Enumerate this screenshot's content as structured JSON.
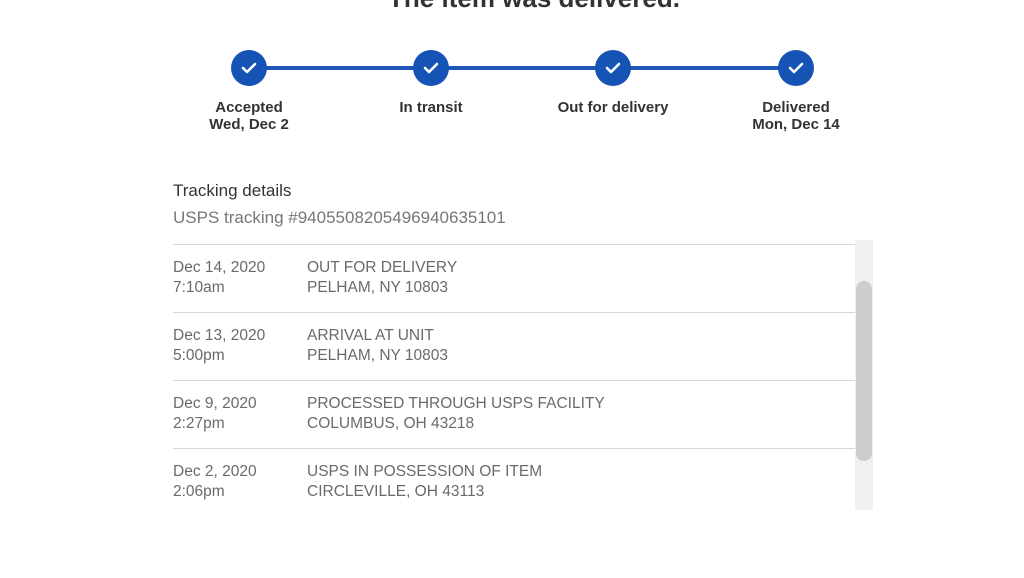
{
  "header": {
    "title": "The item was delivered."
  },
  "progress": {
    "accent_color": "#1553b5",
    "steps": [
      {
        "label": "Accepted",
        "date": "Wed, Dec 2",
        "completed": true,
        "icon": "check-icon"
      },
      {
        "label": "In transit",
        "date": "",
        "completed": true,
        "icon": "check-icon"
      },
      {
        "label": "Out for delivery",
        "date": "",
        "completed": true,
        "icon": "check-icon"
      },
      {
        "label": "Delivered",
        "date": "Mon, Dec 14",
        "completed": true,
        "icon": "check-icon"
      }
    ]
  },
  "tracking": {
    "title": "Tracking details",
    "number_text": "USPS tracking #9405508205496940635101",
    "events": [
      {
        "date": "Dec 14, 2020",
        "time": "7:10am",
        "status": "OUT FOR DELIVERY",
        "location": "PELHAM, NY 10803"
      },
      {
        "date": "Dec 13, 2020",
        "time": "5:00pm",
        "status": "ARRIVAL AT UNIT",
        "location": "PELHAM, NY 10803"
      },
      {
        "date": "Dec 9, 2020",
        "time": "2:27pm",
        "status": "PROCESSED THROUGH USPS FACILITY",
        "location": "COLUMBUS, OH 43218"
      },
      {
        "date": "Dec 2, 2020",
        "time": "2:06pm",
        "status": "USPS IN POSSESSION OF ITEM",
        "location": "CIRCLEVILLE, OH 43113"
      }
    ]
  }
}
